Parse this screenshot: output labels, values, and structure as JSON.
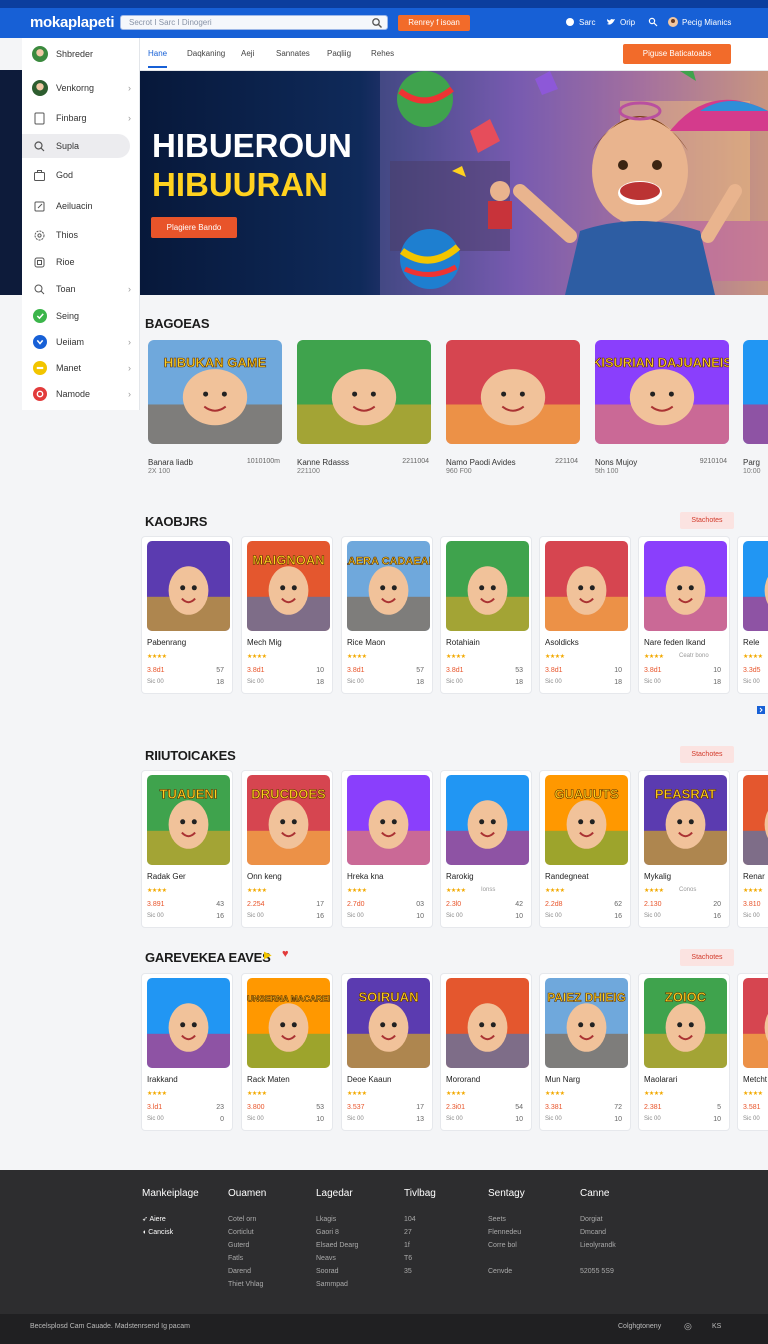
{
  "header": {
    "logo": "mokaplapeti",
    "search_placeholder": "Secrot I Sarc I Dinogeri",
    "cta": "Renrey f isoan",
    "links": [
      "Sarc",
      "Orip",
      "Pecig Mianics"
    ]
  },
  "sidebar": {
    "user": "Shbreder",
    "items": [
      {
        "label": "Venkorng",
        "icon": "avatar-icon",
        "chevron": true
      },
      {
        "label": "Finbarg",
        "icon": "document-icon",
        "chevron": true
      },
      {
        "label": "Supla",
        "icon": "search-icon",
        "chevron": false,
        "active": true
      },
      {
        "label": "God",
        "icon": "briefcase-icon",
        "chevron": false
      },
      {
        "label": "Aeiluacin",
        "icon": "edit-icon",
        "chevron": false
      },
      {
        "label": "Thios",
        "icon": "gear-icon",
        "chevron": false
      },
      {
        "label": "Rioe",
        "icon": "box-icon",
        "chevron": false
      },
      {
        "label": "Toan",
        "icon": "search-icon",
        "chevron": true
      },
      {
        "label": "Seing",
        "icon": "green-badge-icon",
        "chevron": false
      },
      {
        "label": "Ueiiam",
        "icon": "blue-badge-icon",
        "chevron": true
      },
      {
        "label": "Manet",
        "icon": "yellow-badge-icon",
        "chevron": true
      },
      {
        "label": "Namode",
        "icon": "red-badge-icon",
        "chevron": true
      }
    ]
  },
  "subnav": {
    "tabs": [
      "Hane",
      "Daqkaning",
      "Aeji",
      "Sannates",
      "Paqliig",
      "Rehes"
    ],
    "button": "Piguse Baticatoabs"
  },
  "hero": {
    "line1": "HIBUEROUN",
    "line2": "HIBUURAN",
    "button": "Plagiere Bando"
  },
  "featured": {
    "title": "BAGOEAS",
    "cards": [
      {
        "title": "Banara liadb",
        "sub": "2X 100",
        "num": "1010100m",
        "art": "HIBUKAN GAME"
      },
      {
        "title": "Kanne Rdasss",
        "sub": "221100",
        "num": "2211004",
        "art": ""
      },
      {
        "title": "Namo Paodi Avides",
        "sub": "960 F00",
        "num": "221104",
        "art": ""
      },
      {
        "title": "Nons Mujoy",
        "sub": "5th 100",
        "num": "9210104",
        "art": "KISURIAN DAJUANEIS"
      },
      {
        "title": "Parg",
        "sub": "10:00",
        "num": "",
        "art": ""
      }
    ]
  },
  "sections": [
    {
      "title": "KAOBJRS",
      "more": "Stachotes",
      "cards": [
        {
          "title": "Pabenrang",
          "p1": "3.8d1",
          "p2": "Sic 00",
          "q1": "57",
          "q2": "18",
          "sub2": "",
          "art": ""
        },
        {
          "title": "Mech Mig",
          "p1": "3.8d1",
          "p2": "Sic 00",
          "q1": "10",
          "q2": "18",
          "sub2": "",
          "art": "MAIGNOAN"
        },
        {
          "title": "Rice Maon",
          "p1": "3.8d1",
          "p2": "Sic 00",
          "q1": "57",
          "q2": "18",
          "sub2": "",
          "art": "LAERA CADAEAP"
        },
        {
          "title": "Rotahiain",
          "p1": "3.8d1",
          "p2": "Sic 00",
          "q1": "53",
          "q2": "18",
          "sub2": "",
          "art": ""
        },
        {
          "title": "Asoldicks",
          "p1": "3.8d1",
          "p2": "Sic 00",
          "q1": "10",
          "q2": "18",
          "sub2": "",
          "art": ""
        },
        {
          "title": "Nare feden Ikand",
          "p1": "3.8d1",
          "p2": "Sic 00",
          "q1": "10",
          "q2": "18",
          "sub2": "Ceatr bono",
          "art": ""
        },
        {
          "title": "Rele",
          "p1": "3.3d5",
          "p2": "Sic 00",
          "q1": "",
          "q2": "",
          "sub2": "",
          "art": ""
        }
      ]
    },
    {
      "title": "RIIUTOICAKES",
      "more": "Stachotes",
      "cards": [
        {
          "title": "Radak Ger",
          "p1": "3.891",
          "p2": "Sic 00",
          "q1": "43",
          "q2": "16",
          "sub2": "",
          "art": "TUAUENI"
        },
        {
          "title": "Onn keng",
          "p1": "2.254",
          "p2": "Sic 00",
          "q1": "17",
          "q2": "16",
          "sub2": "",
          "art": "DRUCDOES"
        },
        {
          "title": "Hreka kna",
          "p1": "2.7d0",
          "p2": "Sic 00",
          "q1": "03",
          "q2": "10",
          "sub2": "",
          "art": ""
        },
        {
          "title": "Rarokig",
          "p1": "2.3l0",
          "p2": "Sic 00",
          "q1": "42",
          "q2": "10",
          "sub2": "Ionss",
          "art": ""
        },
        {
          "title": "Randegneat",
          "p1": "2.2d8",
          "p2": "Sic 00",
          "q1": "62",
          "q2": "16",
          "sub2": "",
          "art": "GUAUUTS"
        },
        {
          "title": "Mykalig",
          "p1": "2.130",
          "p2": "Sic 00",
          "q1": "20",
          "q2": "16",
          "sub2": "Conos",
          "art": "PEASRAT"
        },
        {
          "title": "Renar",
          "p1": "3.810",
          "p2": "Sic 00",
          "q1": "",
          "q2": "",
          "sub2": "",
          "art": ""
        }
      ]
    },
    {
      "title": "GAREVEKEA EAVES",
      "more": "Stachotes",
      "cards": [
        {
          "title": "Irakkand",
          "p1": "3.ld1",
          "p2": "Sic 00",
          "q1": "23",
          "q2": "0",
          "sub2": "",
          "art": ""
        },
        {
          "title": "Rack Maten",
          "p1": "3.800",
          "p2": "Sic 00",
          "q1": "53",
          "q2": "10",
          "sub2": "",
          "art": "SUNSERNA MACAREIS"
        },
        {
          "title": "Deoe Kaaun",
          "p1": "3.537",
          "p2": "Sic 00",
          "q1": "17",
          "q2": "13",
          "sub2": "",
          "art": "SOIRUAN"
        },
        {
          "title": "Mororand",
          "p1": "2.3i01",
          "p2": "Sic 00",
          "q1": "54",
          "q2": "10",
          "sub2": "",
          "art": ""
        },
        {
          "title": "Mun Narg",
          "p1": "3.381",
          "p2": "Sic 00",
          "q1": "72",
          "q2": "10",
          "sub2": "",
          "art": "PAIEZ DHIEIG"
        },
        {
          "title": "Maolarari",
          "p1": "2.381",
          "p2": "Sic 00",
          "q1": "5",
          "q2": "10",
          "sub2": "",
          "art": "ZOIOC"
        },
        {
          "title": "Metcht",
          "p1": "3.581",
          "p2": "Sic 00",
          "q1": "",
          "q2": "",
          "sub2": "",
          "art": ""
        }
      ]
    }
  ],
  "footer": {
    "cols": [
      {
        "heading": "Mankeiplage",
        "links": [
          "Aiere",
          "Cancisk"
        ]
      },
      {
        "heading": "Ouamen",
        "links": [
          "Cotel orn",
          "Corticlut",
          "Guterd",
          "Fatls",
          "Darend",
          "Thiet Vhlag"
        ]
      },
      {
        "heading": "Lagedar",
        "links": [
          "Lkagis",
          "Gaori 8",
          "Elsaed Dearg",
          "Neavs",
          "Soorad",
          "Sammpad"
        ]
      },
      {
        "heading": "Tivlbag",
        "links": [
          "104",
          "27",
          "1f",
          "T6",
          "35"
        ]
      },
      {
        "heading": "Sentagy",
        "links": [
          "Seets",
          "Flennedeu",
          "Corre bol",
          "",
          "Cenvde"
        ]
      },
      {
        "heading": "Canne",
        "links": [
          "Dorgiat",
          "Dmcand",
          "Lieolyrandk",
          "",
          "52055 5S9"
        ]
      }
    ],
    "copyright": "Becelsplosd Cam Cauade. Madstenrsend Ig pacam",
    "right": "Colghgtoneny",
    "right2": "KS"
  },
  "colors": {
    "primary": "#1760d6",
    "accent": "#f26b2a",
    "hero_yellow": "#ffd21f"
  }
}
